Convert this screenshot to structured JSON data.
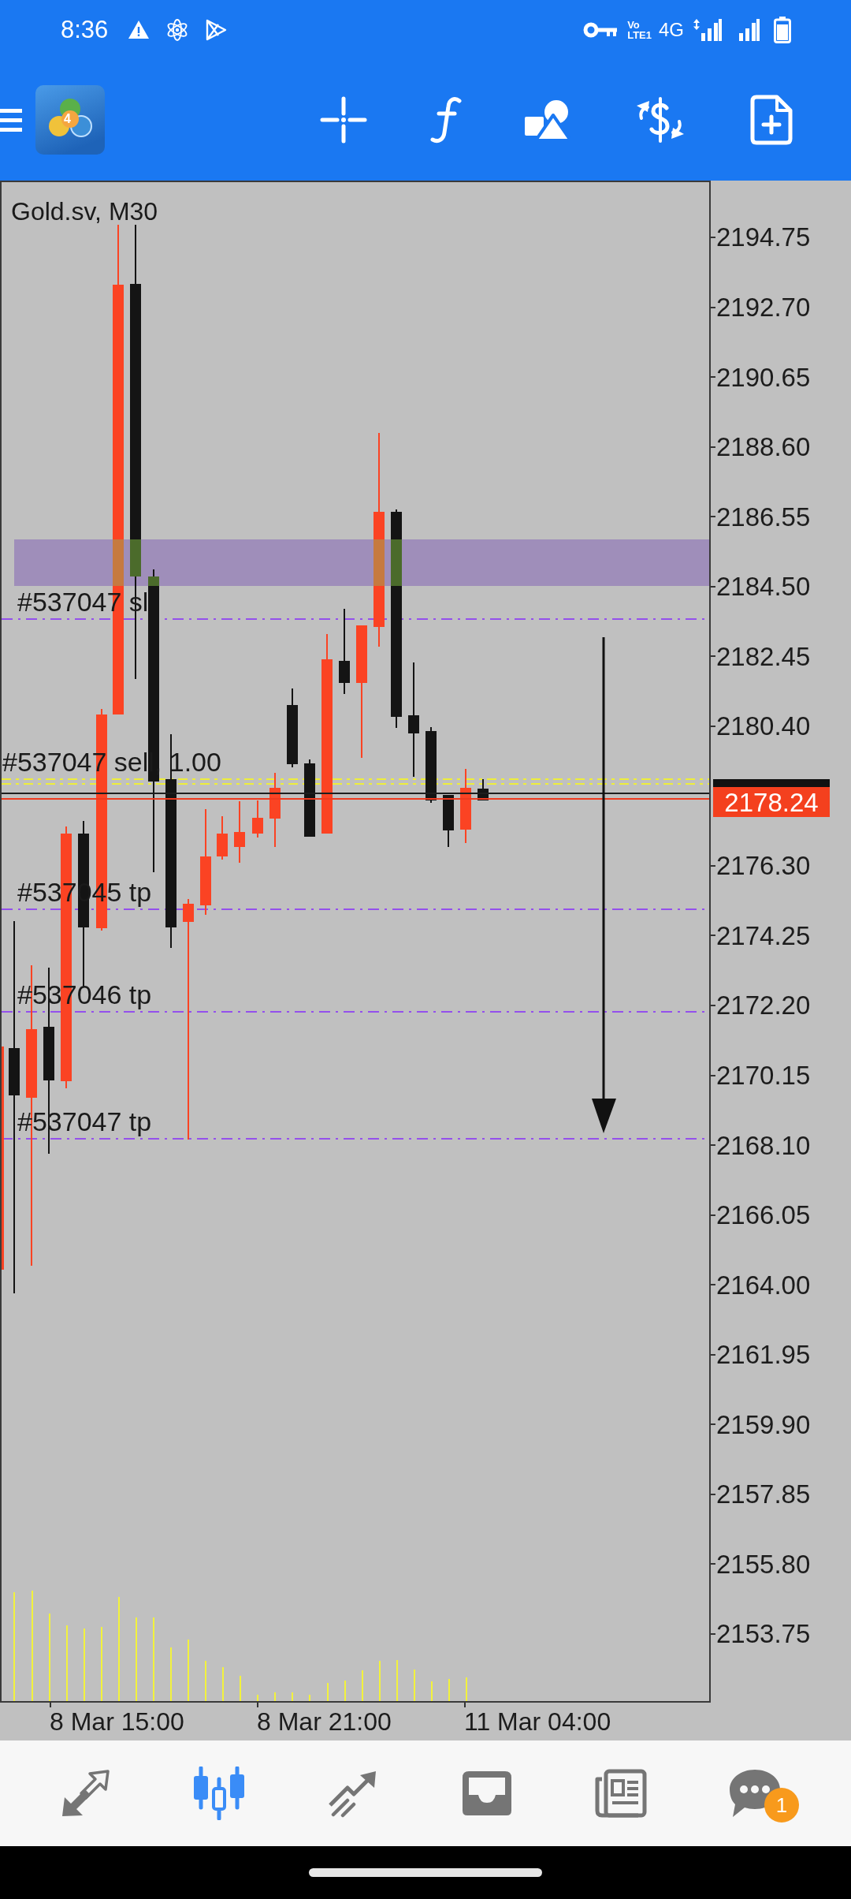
{
  "status_bar": {
    "time": "8:36",
    "volte_top": "Vo",
    "volte_bottom": "LTE1",
    "network": "4G"
  },
  "toolbar": {
    "logo_badge": "4"
  },
  "chart": {
    "title": "Gold.sv, M30",
    "trade_levels": [
      {
        "kind": "stop_loss",
        "label": "#537047 sl"
      },
      {
        "kind": "order",
        "label": "#537047 sell, 1.00"
      },
      {
        "kind": "take_profit",
        "label": "#537045 tp"
      },
      {
        "kind": "take_profit",
        "label": "#537046 tp"
      },
      {
        "kind": "take_profit",
        "label": "#537047 tp"
      }
    ],
    "price_axis": {
      "labels": [
        "2194.75",
        "2192.70",
        "2190.65",
        "2188.60",
        "2186.55",
        "2184.50",
        "2182.45",
        "2180.40",
        "2176.30",
        "2174.25",
        "2172.20",
        "2170.15",
        "2168.10",
        "2166.05",
        "2164.00",
        "2161.95",
        "2159.90",
        "2157.85",
        "2155.80",
        "2153.75"
      ],
      "current_price": "2178.24"
    },
    "time_axis": {
      "labels": [
        "8 Mar 15:00",
        "8 Mar 21:00",
        "11 Mar 04:00"
      ]
    }
  },
  "bottom_nav": [
    {
      "selected": false
    },
    {
      "selected": true
    },
    {
      "selected": false
    },
    {
      "selected": false
    },
    {
      "selected": false
    },
    {
      "selected": false,
      "badge": "1"
    }
  ]
}
